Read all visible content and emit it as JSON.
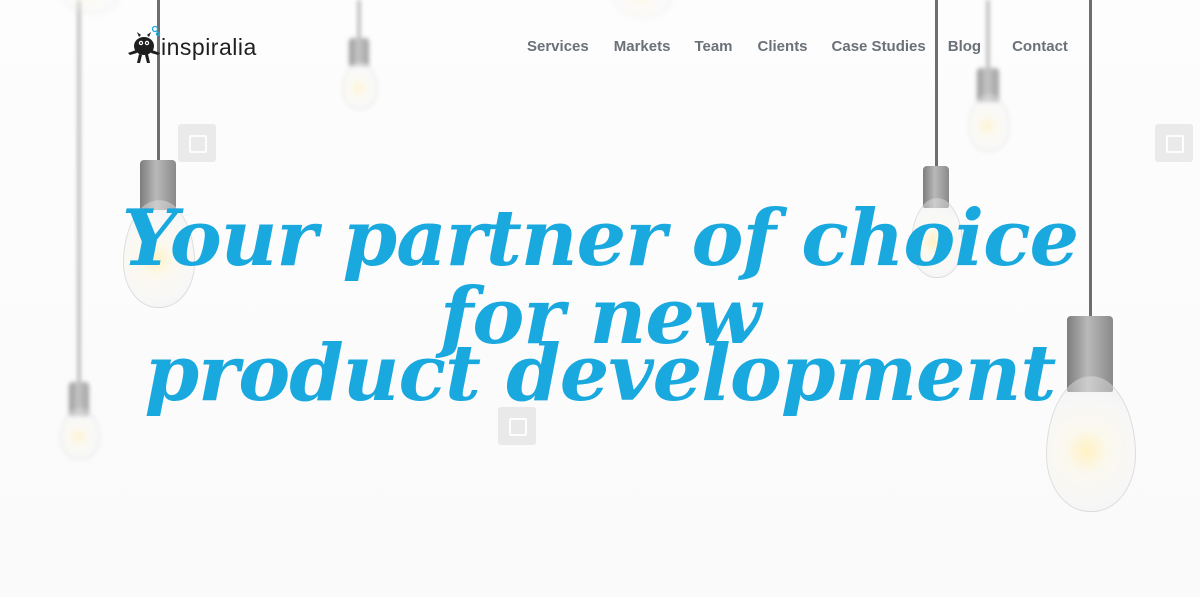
{
  "brand": {
    "name": "inspiralia",
    "logo_icon": "mascot-icon"
  },
  "nav": {
    "items": [
      {
        "label": "Services"
      },
      {
        "label": "Markets"
      },
      {
        "label": "Team"
      },
      {
        "label": "Clients"
      },
      {
        "label": "Case Studies"
      },
      {
        "label": "Blog"
      },
      {
        "label": "Contact"
      }
    ]
  },
  "hero": {
    "line1": "Your partner of choice for new",
    "line2": "product development"
  },
  "colors": {
    "accent": "#19a9df",
    "nav_text": "#6b7178",
    "logo_text": "#1f1f1f"
  }
}
